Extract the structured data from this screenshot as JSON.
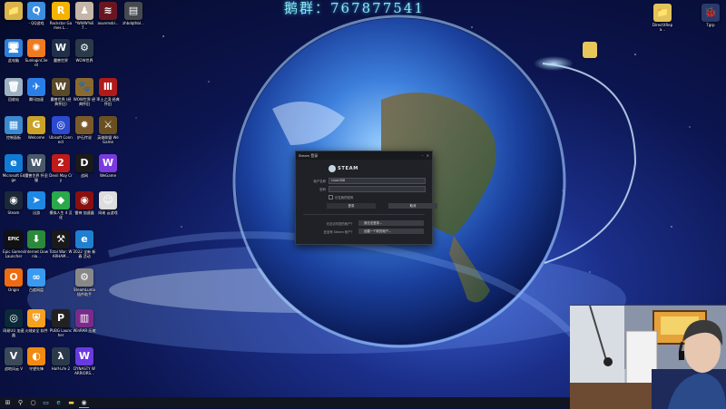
{
  "banner_text": "鹅群：767877541",
  "desktop_icons": [
    {
      "label": "",
      "color": "#d9b44a",
      "glyph": "📁",
      "icon": "folder-icon"
    },
    {
      "label": "- QQ游戏",
      "color": "#3b8fe0",
      "glyph": "Q",
      "icon": "qq-game-icon"
    },
    {
      "label": "Rockstar Games L...",
      "color": "#f5b300",
      "glyph": "R",
      "icon": "rockstar-icon"
    },
    {
      "label": "*WWW%67...",
      "color": "#c5b6a8",
      "glyph": "♟",
      "icon": "photo-icon"
    },
    {
      "label": "asunmsbl...",
      "color": "#6a1620",
      "glyph": "≋",
      "icon": "image-icon"
    },
    {
      "label": "zhbdqthbl...",
      "color": "#444a4f",
      "glyph": "▤",
      "icon": "image-icon"
    },
    {
      "label": "此电脑",
      "color": "#2e7fd9",
      "glyph": "🖥",
      "icon": "computer-icon"
    },
    {
      "label": "SunloginClient",
      "color": "#f07a20",
      "glyph": "✺",
      "icon": "sunlogin-icon"
    },
    {
      "label": "魔兽世界",
      "color": "#20304a",
      "glyph": "W",
      "icon": "wow-icon"
    },
    {
      "label": "WOW世界",
      "color": "#2a3a4a",
      "glyph": "⚙",
      "icon": "wow-world-icon"
    },
    {
      "label": "回收站",
      "color": "#9fb2c4",
      "glyph": "🗑",
      "icon": "recycle-bin-icon"
    },
    {
      "label": "腾讯加速",
      "color": "#2a7fe6",
      "glyph": "✈",
      "icon": "tencent-booster-icon"
    },
    {
      "label": "魔兽世界 (经典怀旧)",
      "color": "#5a4a2a",
      "glyph": "W",
      "icon": "wow-classic-icon"
    },
    {
      "label": "WOW世界 经典怀旧",
      "color": "#8a6a30",
      "glyph": "🐾",
      "icon": "paw-icon"
    },
    {
      "label": "率土之滨 经典怀旧",
      "color": "#b01a1a",
      "glyph": "Ⅲ",
      "icon": "game-icon"
    },
    {
      "label": "控制面板",
      "color": "#3a8ad0",
      "glyph": "▦",
      "icon": "control-panel-icon"
    },
    {
      "label": "Welcome",
      "color": "#c9a227",
      "glyph": "G",
      "icon": "welcome-icon"
    },
    {
      "label": "Ubisoft Connect",
      "color": "#2b4ad0",
      "glyph": "◎",
      "icon": "ubisoft-icon"
    },
    {
      "label": "炉石传说",
      "color": "#7a5a2a",
      "glyph": "✹",
      "icon": "hearthstone-icon"
    },
    {
      "label": "英雄联盟 WeGame",
      "color": "#6a5020",
      "glyph": "⚔",
      "icon": "wegame-icon"
    },
    {
      "label": "Microsoft Edge",
      "color": "#0f7bd4",
      "glyph": "e",
      "icon": "edge-icon"
    },
    {
      "label": "魔兽世界 怀旧服",
      "color": "#4a5a6a",
      "glyph": "W",
      "icon": "wow-icon"
    },
    {
      "label": "Devil May Cry",
      "color": "#c01a1a",
      "glyph": "2",
      "icon": "dmc-icon"
    },
    {
      "label": "战网",
      "color": "#1a1a1a",
      "glyph": "D",
      "icon": "battlenet-icon"
    },
    {
      "label": "WeGame",
      "color": "#7a3ae0",
      "glyph": "W",
      "icon": "wegame-icon"
    },
    {
      "label": "Steam",
      "color": "#1b2838",
      "glyph": "◉",
      "icon": "steam-icon"
    },
    {
      "label": "迅游",
      "color": "#1e88e5",
      "glyph": "➤",
      "icon": "xunyou-icon"
    },
    {
      "label": "模拟人生 4 汉化",
      "color": "#2aa84a",
      "glyph": "◆",
      "icon": "sims-icon"
    },
    {
      "label": "雷神 加速器",
      "color": "#8a1010",
      "glyph": "◉",
      "icon": "leishen-icon"
    },
    {
      "label": "网易 云游戏",
      "color": "#ddd",
      "glyph": "☺",
      "icon": "avatar-icon"
    },
    {
      "label": "Epic Games Launcher",
      "color": "#111",
      "glyph": "EPIC",
      "icon": "epic-icon"
    },
    {
      "label": "Internet Downlo...",
      "color": "#2a8a3a",
      "glyph": "⬇",
      "icon": "idm-icon"
    },
    {
      "label": "Total War: WARHAM...",
      "color": "#1a1a1a",
      "glyph": "⚒",
      "icon": "warhammer-icon"
    },
    {
      "label": "2022 全新 新春 活动",
      "color": "#1f7fd0",
      "glyph": "e",
      "icon": "edge-icon"
    },
    {
      "label": "Origin",
      "color": "#f06a10",
      "glyph": "O",
      "icon": "origin-icon"
    },
    {
      "label": "百度网盘",
      "color": "#3a9af0",
      "glyph": "∞",
      "icon": "baidu-disk-icon"
    },
    {
      "label": "SteamLuma 插件助手",
      "color": "#888",
      "glyph": "⚙",
      "icon": "tool-icon"
    },
    {
      "label": "网易UU 加速器",
      "color": "#0a2a3a",
      "glyph": "◎",
      "icon": "uu-icon"
    },
    {
      "label": "火绒安全 软件",
      "color": "#f5a020",
      "glyph": "⛨",
      "icon": "shield-icon"
    },
    {
      "label": "PUBG Launcher",
      "color": "#222",
      "glyph": "P",
      "icon": "pubg-icon"
    },
    {
      "label": "WinRAR 压缩",
      "color": "#7a2a8a",
      "glyph": "▥",
      "icon": "winrar-icon"
    },
    {
      "label": "战地风云 V",
      "color": "#3a4a5a",
      "glyph": "V",
      "icon": "bf-icon"
    },
    {
      "label": "守望先锋",
      "color": "#f08a10",
      "glyph": "◐",
      "icon": "overwatch-icon"
    },
    {
      "label": "Half-Life 2",
      "color": "#2a3a4a",
      "glyph": "λ",
      "icon": "hl-icon"
    },
    {
      "label": "DYNASTY WARRIORS...",
      "color": "#6a3ae0",
      "glyph": "W",
      "icon": "wegame-icon"
    }
  ],
  "desktop_right_icons": [
    {
      "label": "DirectXRepa...",
      "color": "#e3c45a",
      "glyph": "📁",
      "icon": "folder-icon"
    },
    {
      "label": "Tgrp",
      "color": "#2b3a6a",
      "glyph": "🐞",
      "icon": "app-icon"
    }
  ],
  "floating_folder": {
    "label": "",
    "icon": "folder-icon"
  },
  "steam_dialog": {
    "title": "Steam 登录",
    "brand": "STEAM",
    "account_label": "帐户名称",
    "account_value": "cnwz308",
    "password_label": "密码",
    "password_value": "",
    "remember_label": "记住我的密码",
    "login_button": "登录",
    "cancel_button": "取消",
    "forgot_prompt": "无法访问您的帐户？",
    "forgot_button": "我无法登录...",
    "create_prompt": "还没有 Steam 帐户？",
    "create_button": "创建一个新的帐户..."
  },
  "taskbar_items": [
    {
      "icon": "windows-start-icon",
      "glyph": "⊞"
    },
    {
      "icon": "search-icon",
      "glyph": "⚲"
    },
    {
      "icon": "task-view-icon",
      "glyph": "○"
    },
    {
      "icon": "file-explorer-icon",
      "glyph": "▭"
    },
    {
      "icon": "edge-icon",
      "glyph": "e"
    },
    {
      "icon": "folder-icon",
      "glyph": "▬"
    },
    {
      "icon": "steam-icon",
      "glyph": "◉"
    }
  ]
}
